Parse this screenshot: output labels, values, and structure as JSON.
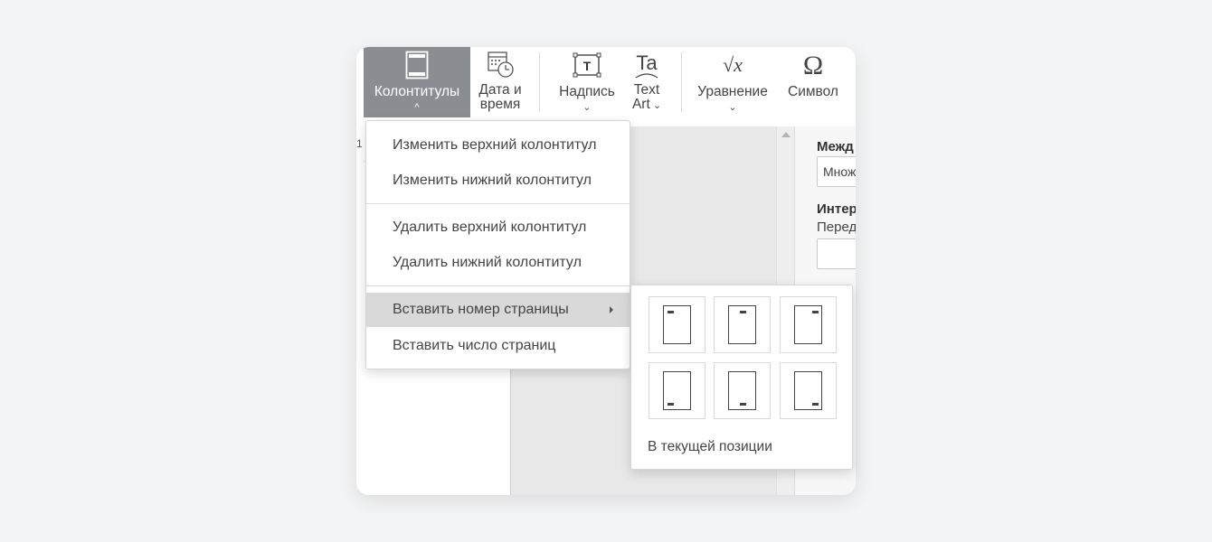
{
  "toolbar": {
    "headers_footers": {
      "label": "Колонтитулы",
      "chevron": "^"
    },
    "date_time": {
      "line1": "Дата и",
      "line2": "время"
    },
    "text_box": {
      "label": "Надпись",
      "chevron": "⌄"
    },
    "text_art": {
      "line1": "Text",
      "line2": "Art",
      "chevron": "⌄"
    },
    "equation": {
      "label": "Уравнение",
      "chevron": "⌄"
    },
    "symbol": {
      "label": "Символ"
    },
    "text_art_icon": "Ta",
    "equation_icon": "√x",
    "symbol_icon": "Ω",
    "text_box_icon": "T"
  },
  "ruler": {
    "number": "1"
  },
  "right_panel": {
    "spacing_title": "Межд",
    "spacing_value": "Множ",
    "indents_title": "Интер",
    "before_label": "Перед"
  },
  "menu": {
    "items": [
      {
        "label": "Изменить верхний колонтитул"
      },
      {
        "label": "Изменить нижний колонтитул"
      },
      {
        "label": "Удалить верхний колонтитул"
      },
      {
        "label": "Удалить нижний колонтитул"
      },
      {
        "label": "Вставить номер страницы"
      },
      {
        "label": "Вставить число страниц"
      }
    ]
  },
  "submenu": {
    "positions": [
      "top-left",
      "top-center",
      "top-right",
      "bottom-left",
      "bottom-center",
      "bottom-right"
    ],
    "current_position_label": "В текущей позиции"
  },
  "colors": {
    "active_tab": "#8a8d91",
    "menu_highlight": "#d9d9d9",
    "canvas_gray": "#e8e8e8"
  }
}
